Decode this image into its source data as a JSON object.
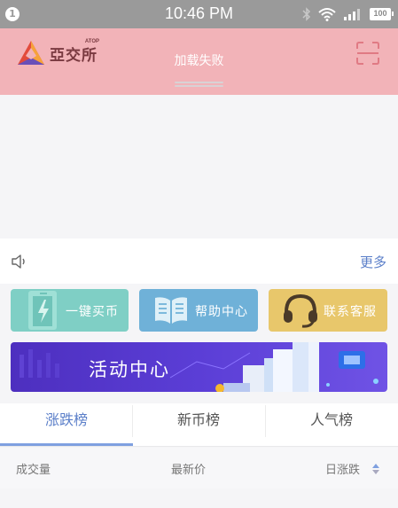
{
  "status_bar": {
    "notification_count": "1",
    "time": "10:46 PM",
    "battery": "100"
  },
  "header": {
    "logo_text": "亞交所",
    "logo_sub": "ATOP",
    "banner_message": "加载失败"
  },
  "notice": {
    "more_label": "更多"
  },
  "quick_actions": [
    {
      "label": "一键买币",
      "icon": "phone-charge-icon",
      "color": "#7fcfc5"
    },
    {
      "label": "帮助中心",
      "icon": "open-book-icon",
      "color": "#6fb1d8"
    },
    {
      "label": "联系客服",
      "icon": "headset-icon",
      "color": "#e8c76b"
    }
  ],
  "activity": {
    "title": "活动中心"
  },
  "tabs": [
    {
      "label": "涨跌榜"
    },
    {
      "label": "新币榜"
    },
    {
      "label": "人气榜"
    }
  ],
  "active_tab": "涨跌榜",
  "table_header": {
    "volume": "成交量",
    "latest_price": "最新价",
    "daily_change": "日涨跌"
  },
  "colors": {
    "accent": "#5b7fc9",
    "banner_bg": "#f2b3b8",
    "status_bar": "#9a9a9a"
  }
}
